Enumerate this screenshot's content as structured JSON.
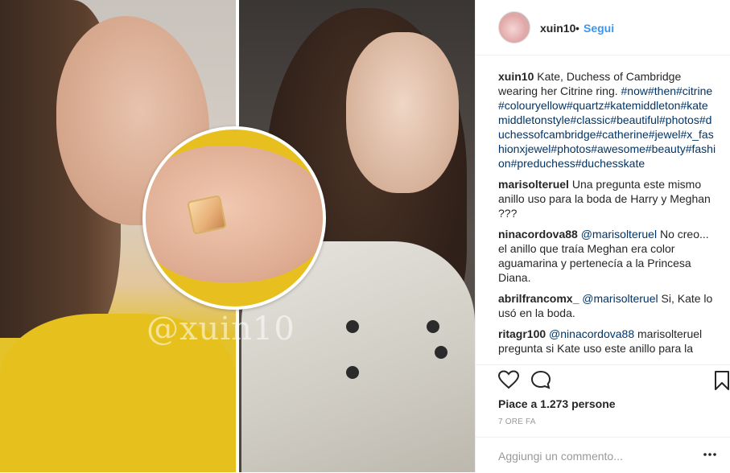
{
  "post": {
    "username": "xuin10",
    "dot": "•",
    "follow_label": "Segui",
    "caption": {
      "username": "xuin10",
      "text": "Kate, Duchess of Cambridge wearing her Citrine ring.",
      "hashtags": "#now#then#citrine#colouryellow#quartz#katemiddleton#katemiddletonstyle#classic#beautiful#photos#duchessofcambridge#catherine#jewel#x_fashionxjewel#photos#awesome#beauty#fashion#preduchess#duchesskate"
    },
    "comments": [
      {
        "username": "marisolteruel",
        "mention": "",
        "text": "Una pregunta este mismo anillo uso para la boda de Harry y Meghan ???"
      },
      {
        "username": "ninacordova88",
        "mention": "@marisolteruel",
        "text": "No creo... el anillo que traía Meghan era color aguamarina y pertenecía a la Princesa Diana."
      },
      {
        "username": "abrilfrancomx_",
        "mention": "@marisolteruel",
        "text": "Si, Kate lo usó en la boda."
      },
      {
        "username": "ritagr100",
        "mention": "@ninacordova88",
        "text": "marisolteruel pregunta si Kate uso este anillo para la"
      }
    ],
    "likes": "Piace a 1.273 persone",
    "timestamp": "7 ORE FA",
    "add_comment_placeholder": "Aggiungi un commento...",
    "more_icon": "ellipsis-icon"
  },
  "image": {
    "watermark": "@xuin10"
  },
  "icons": {
    "like": "heart-outline-icon",
    "comment": "speech-bubble-icon",
    "save": "bookmark-icon"
  }
}
